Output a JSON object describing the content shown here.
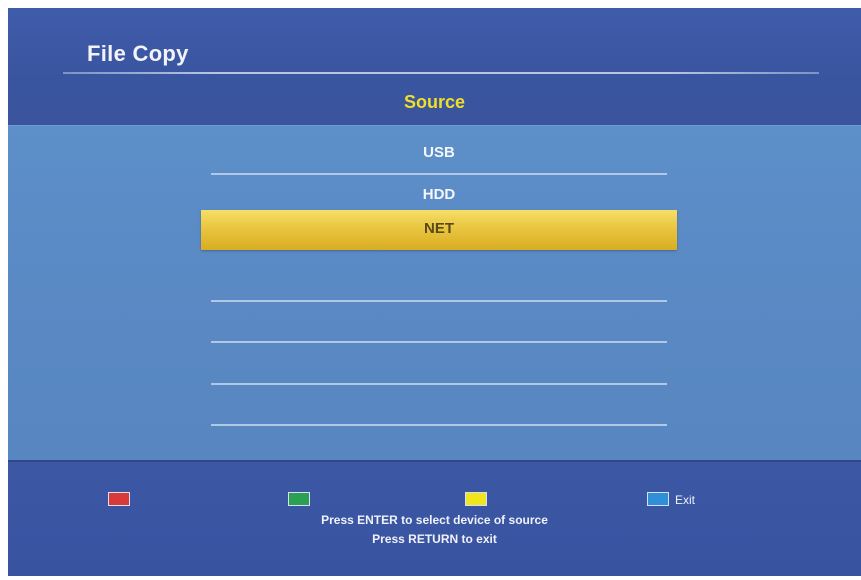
{
  "header": {
    "title": "File Copy",
    "section_title": "Source"
  },
  "source_list": {
    "items": [
      {
        "label": "USB",
        "selected": false
      },
      {
        "label": "HDD",
        "selected": false
      },
      {
        "label": "NET",
        "selected": true
      },
      {
        "label": "",
        "selected": false
      },
      {
        "label": "",
        "selected": false
      },
      {
        "label": "",
        "selected": false
      },
      {
        "label": "",
        "selected": false
      }
    ]
  },
  "footer": {
    "keys": [
      {
        "icon": "red-key-icon",
        "color": "#d83a3a",
        "label": ""
      },
      {
        "icon": "green-key-icon",
        "color": "#2aa053",
        "label": ""
      },
      {
        "icon": "yellow-key-icon",
        "color": "#f1e51e",
        "label": ""
      },
      {
        "icon": "blue-key-icon",
        "color": "#2f8fd9",
        "label": "Exit"
      }
    ],
    "hint_enter": "Press ENTER to select device of source",
    "hint_return": "Press RETURN to exit"
  },
  "colors": {
    "background": "#3d59a6",
    "panel": "#5a89c4",
    "accent_title": "#f0df2a",
    "selection": "#e9c540"
  }
}
